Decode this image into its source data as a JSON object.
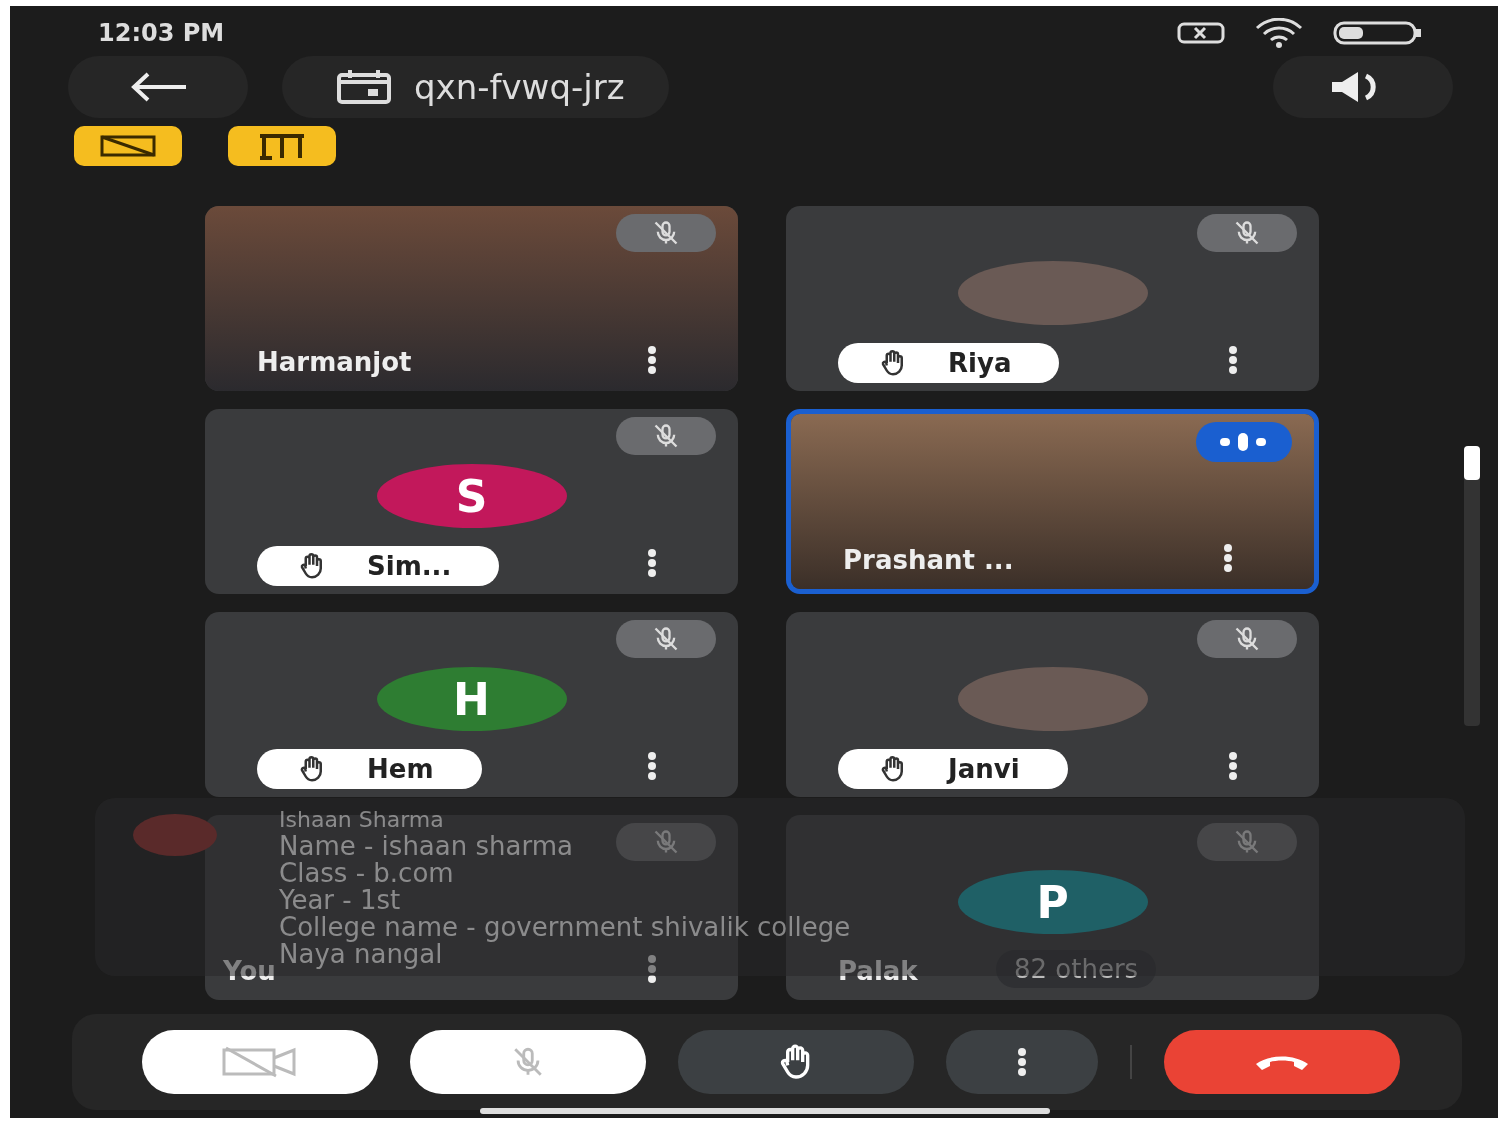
{
  "status_bar": {
    "time": "12:03 PM"
  },
  "header": {
    "meeting_code": "qxn-fvwq-jrz"
  },
  "tiles": [
    {
      "name": "Harmanjot",
      "kind": "video",
      "hand_raised": false,
      "muted": true,
      "speaking": false
    },
    {
      "name": "Riya",
      "kind": "photo",
      "hand_raised": true,
      "muted": true,
      "speaking": false
    },
    {
      "name": "Sim...",
      "kind": "initial",
      "initial": "S",
      "color": "#c2185b",
      "hand_raised": true,
      "muted": true,
      "speaking": false
    },
    {
      "name": "Prashant ...",
      "kind": "video",
      "hand_raised": false,
      "muted": false,
      "speaking": true
    },
    {
      "name": "Hem",
      "kind": "initial",
      "initial": "H",
      "color": "#2e7d32",
      "hand_raised": true,
      "muted": true,
      "speaking": false
    },
    {
      "name": "Janvi",
      "kind": "photo",
      "hand_raised": true,
      "muted": true,
      "speaking": false
    },
    {
      "name": "You",
      "kind": "blank",
      "hand_raised": false,
      "muted": true,
      "speaking": false
    },
    {
      "name": "Palak",
      "kind": "initial",
      "initial": "P",
      "color": "#1f6066",
      "hand_raised": false,
      "muted": true,
      "speaking": false,
      "others": "82 others"
    }
  ],
  "chat_toast": {
    "sender": "Ishaan Sharma",
    "lines": [
      "Name - ishaan sharma",
      "Class - b.com",
      "Year - 1st",
      "College name - government shivalik college",
      "Naya nangal"
    ]
  },
  "controls": {
    "camera_on": false,
    "mic_on": false
  }
}
